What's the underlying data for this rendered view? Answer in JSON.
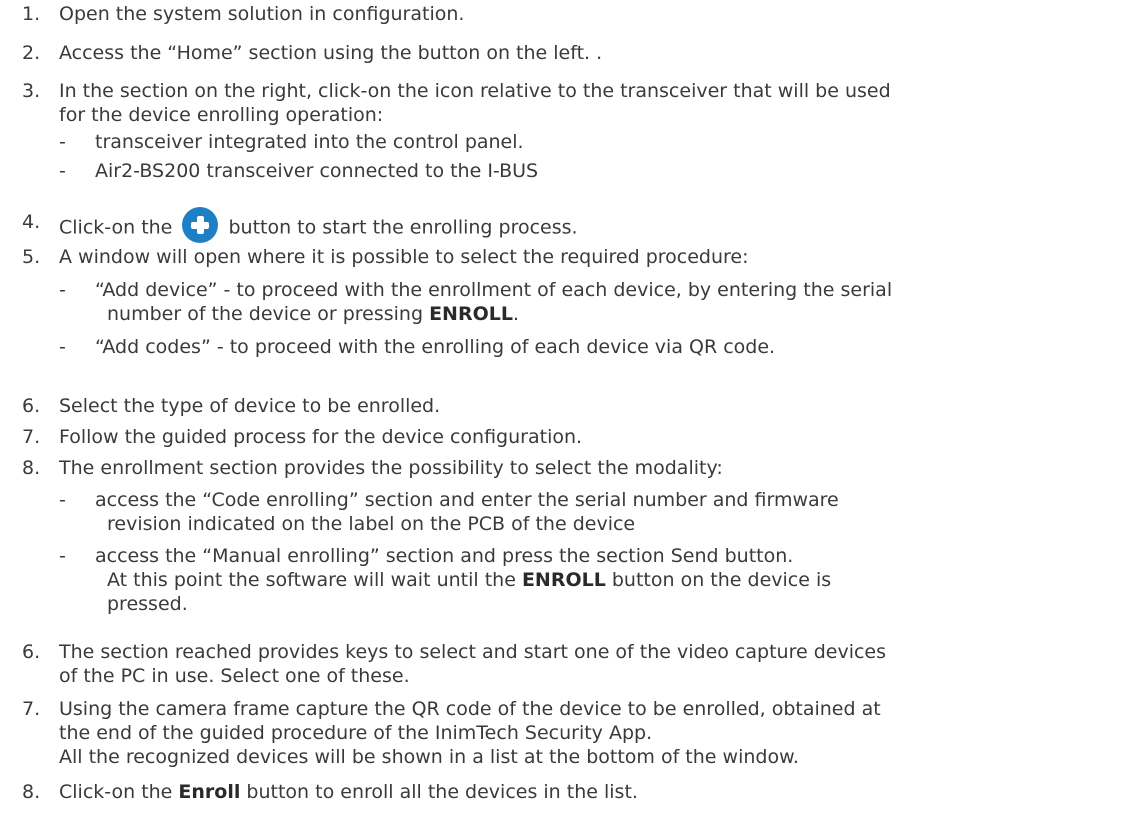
{
  "list_a": [
    {
      "num": "1.",
      "text": "Open the system solution in configuration."
    },
    {
      "num": "2.",
      "text": "Access the “Home” section using the button on the left. ."
    },
    {
      "num": "3.",
      "line1": "In the section on the right, click-on the icon relative to the transceiver that will be used",
      "line2": "for the device enrolling operation:",
      "subs": [
        {
          "dash": "-",
          "text": "transceiver integrated into the control panel."
        },
        {
          "dash": "-",
          "text": "Air2-BS200 transceiver connected to the I-BUS"
        }
      ]
    },
    {
      "num": "4.",
      "before": "Click-on the",
      "after": "button to start the enrolling process.",
      "icon": "plus-circle-icon"
    },
    {
      "num": "5.",
      "text": "A window will open where it is possible to select the required procedure:",
      "subs": [
        {
          "dash": "-",
          "line1": "“Add device” -  to proceed with the enrollment of each device, by entering the serial",
          "line2_pre": "number of the device or pressing ",
          "line2_bold": "ENROLL",
          "line2_post": "."
        },
        {
          "dash": "-",
          "text": "“Add codes” - to proceed with the enrolling of each device via QR code."
        }
      ]
    }
  ],
  "list_b": [
    {
      "num": "6.",
      "text": "Select the type of device to be enrolled."
    },
    {
      "num": "7.",
      "text": "Follow the guided process for the device configuration."
    },
    {
      "num": "8.",
      "text": "The enrollment section provides the possibility to select the modality:",
      "subs": [
        {
          "dash": "-",
          "line1": "access the “Code enrolling” section and enter the serial number and firmware",
          "line2": "revision indicated on the label on the PCB of the device"
        },
        {
          "dash": "-",
          "line1": "access the “Manual enrolling” section and press the section Send button.",
          "line2_pre": "At this point the software will wait until the ",
          "line2_bold": "ENROLL",
          "line2_post": " button on the device is",
          "line3": "pressed."
        }
      ]
    }
  ],
  "list_c": [
    {
      "num": "6.",
      "line1": "The section reached provides keys to select and start one of the video capture devices",
      "line2": "of the PC in use. Select one of these."
    },
    {
      "num": "7.",
      "line1": "Using the camera frame capture the QR code of the device to be enrolled, obtained at",
      "line2": "the end of the guided procedure of the InimTech Security App.",
      "line3": "All the recognized devices will be shown in a list at the bottom of the window."
    },
    {
      "num": "8.",
      "pre": "Click-on the ",
      "bold": "Enroll",
      "post": " button to enroll all the devices in the list."
    }
  ]
}
